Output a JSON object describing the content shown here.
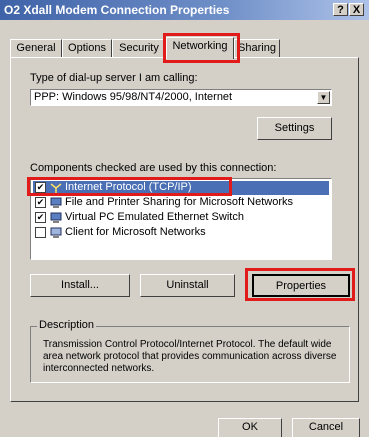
{
  "window": {
    "title": "O2 Xdall Modem Connection Properties",
    "help_glyph": "?",
    "close_glyph": "X"
  },
  "tabs": [
    {
      "label": "General"
    },
    {
      "label": "Options"
    },
    {
      "label": "Security"
    },
    {
      "label": "Networking"
    },
    {
      "label": "Sharing"
    }
  ],
  "server": {
    "label": "Type of dial-up server I am calling:",
    "value": "PPP: Windows 95/98/NT4/2000, Internet",
    "settings_label": "Settings"
  },
  "components": {
    "label": "Components checked are used by this connection:",
    "items": [
      {
        "label": "Internet Protocol (TCP/IP)",
        "checked": true,
        "icon": "network-protocol-icon"
      },
      {
        "label": "File and Printer Sharing for Microsoft Networks",
        "checked": true,
        "icon": "network-service-icon"
      },
      {
        "label": "Virtual PC Emulated Ethernet Switch",
        "checked": true,
        "icon": "network-service-icon"
      },
      {
        "label": "Client for Microsoft Networks",
        "checked": false,
        "icon": "network-client-icon"
      }
    ],
    "install_label": "Install...",
    "uninstall_label": "Uninstall",
    "properties_label": "Properties"
  },
  "description": {
    "legend": "Description",
    "text": "Transmission Control Protocol/Internet Protocol. The default wide area network protocol that provides communication across diverse interconnected networks."
  },
  "footer": {
    "ok_label": "OK",
    "cancel_label": "Cancel"
  },
  "highlight_color": "#e11a1a"
}
